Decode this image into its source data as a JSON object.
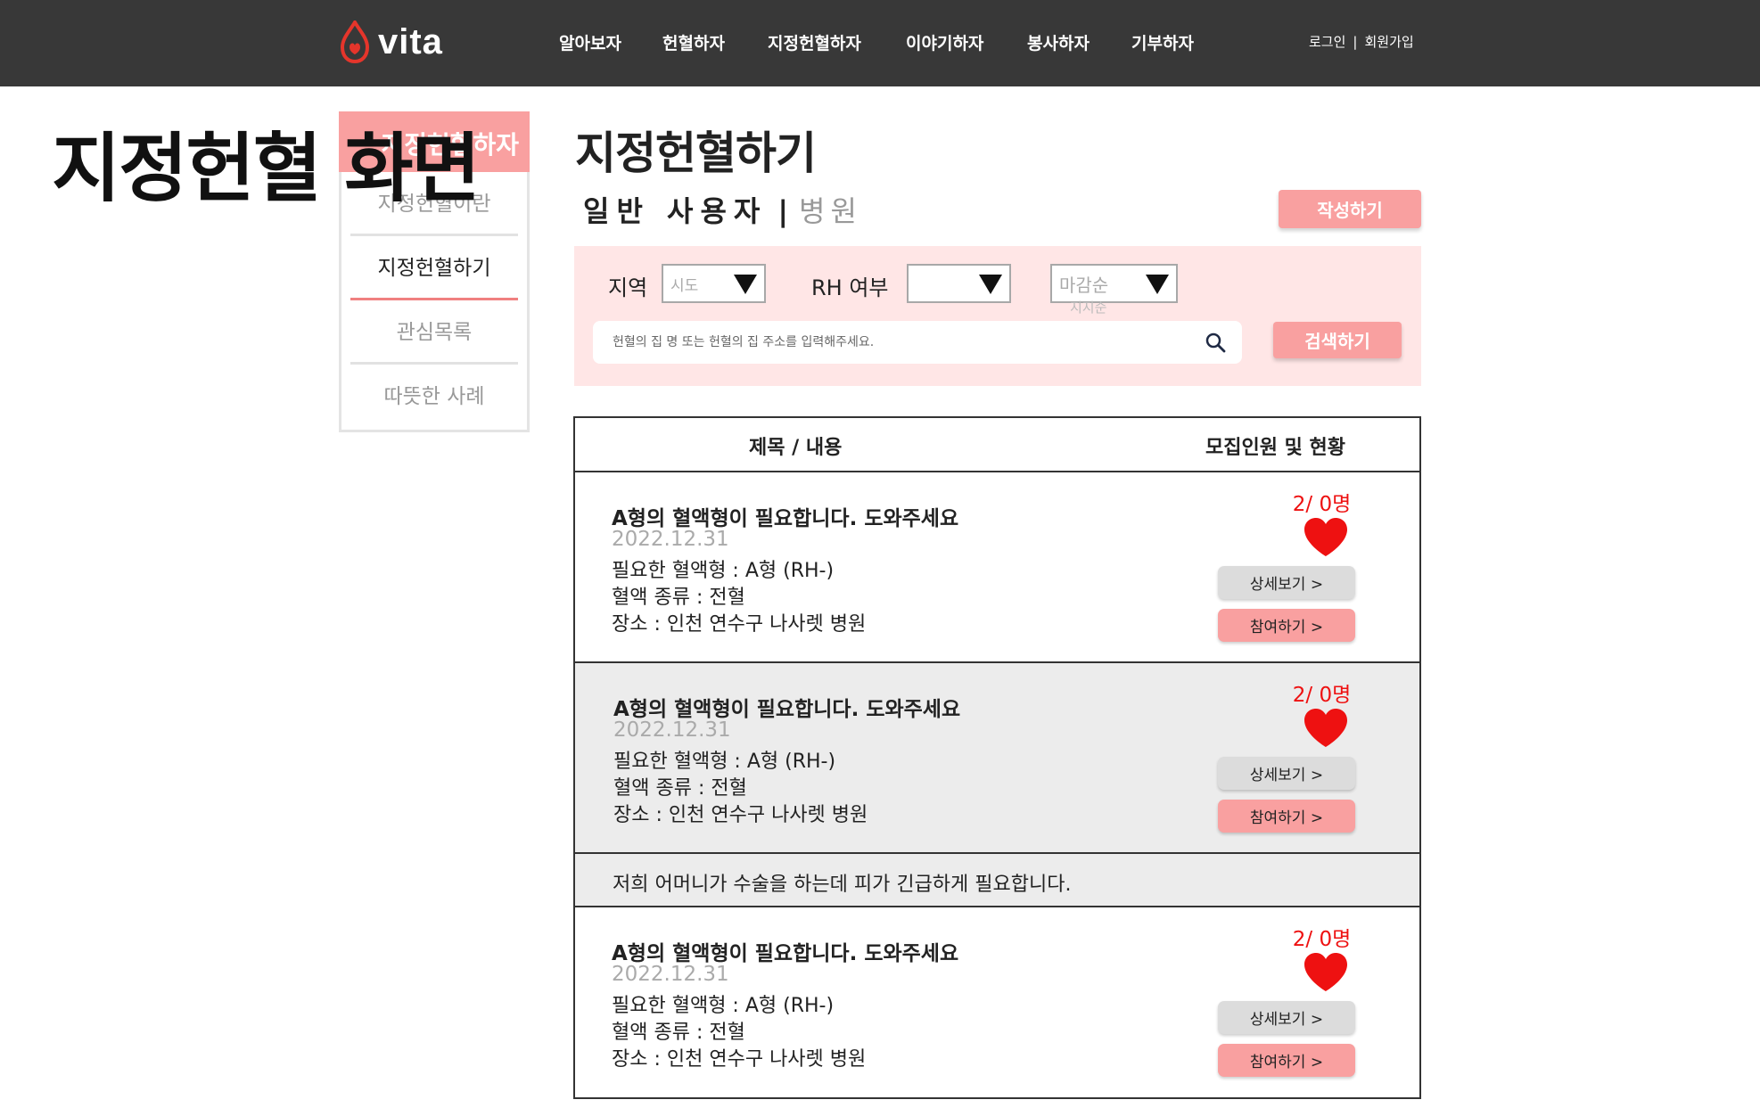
{
  "header": {
    "logo_text": "vita",
    "nav": [
      "알아보자",
      "헌혈하자",
      "지정헌혈하자",
      "이야기하자",
      "봉사하자",
      "기부하자"
    ],
    "login": "로그인",
    "auth_sep": "|",
    "signup": "회원가입"
  },
  "overlay_label": "지정헌혈 화면",
  "sidebar": {
    "heading": "지정헌혈하자",
    "items": [
      "지정헌혈이란",
      "지정헌혈하기",
      "관심목록",
      "따뜻한 사례"
    ],
    "active_index": 1
  },
  "main": {
    "title": "지정헌혈하기",
    "tab_user": "일반 사용자",
    "tab_sep": "|",
    "tab_hospital": "병원",
    "write_button": "작성하기"
  },
  "filter": {
    "region_label": "지역",
    "region_select": "시도",
    "rh_label": "RH 여부",
    "rh_select": "",
    "sort_select": "마감순",
    "sort_sub": "지지순",
    "search_placeholder": "헌혈의 집 명 또는 헌혈의 집 주소를 입력해주세요.",
    "search_button": "검색하기"
  },
  "table": {
    "col_title": "제목 / 내용",
    "col_status": "모집인원 및 현황",
    "detail_button": "상세보기 >",
    "join_button": "참여하기 >",
    "rows": [
      {
        "title": "A형의 혈액형이 필요합니다. 도와주세요",
        "date": "2022.12.31",
        "blood_type": "필요한 혈액형 : A형 (RH-)",
        "blood_kind": "혈액 종류 : 전혈",
        "place": "장소 : 인천 연수구 나사렛 병원",
        "count": "2/ 0명"
      },
      {
        "title": "A형의 혈액형이 필요합니다. 도와주세요",
        "date": "2022.12.31",
        "blood_type": "필요한 혈액형 : A형 (RH-)",
        "blood_kind": "혈액 종류 : 전혈",
        "place": "장소 : 인천 연수구 나사렛 병원",
        "count": "2/ 0명",
        "expanded_text": "저희 어머니가 수술을 하는데 피가 긴급하게 필요합니다."
      },
      {
        "title": "A형의 혈액형이 필요합니다. 도와주세요",
        "date": "2022.12.31",
        "blood_type": "필요한 혈액형 : A형 (RH-)",
        "blood_kind": "혈액 종류 : 전혈",
        "place": "장소 : 인천 연수구 나사렛 병원",
        "count": "2/ 0명"
      }
    ]
  },
  "colors": {
    "header_bg": "#383838",
    "accent_pink": "#f9a0a0",
    "filter_bg": "#ffe6e6",
    "heart_red": "#ee1111",
    "logo_red": "#e5352b"
  }
}
